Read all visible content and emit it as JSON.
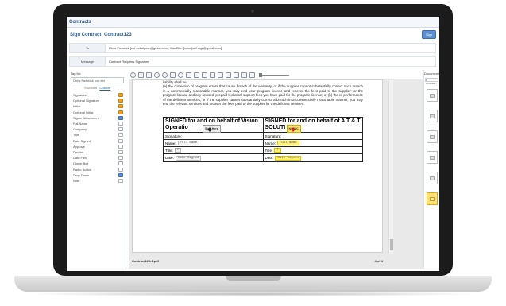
{
  "app": {
    "title": "Contracts"
  },
  "header": {
    "title": "Sign Contract: Contract123",
    "sign_label": "Sign"
  },
  "to": {
    "label": "To",
    "value": "Chris Fishwick [cnf.ext.signer@gmail.com]; MaoDtu Quinn [cnf.mgr@gmail.com];"
  },
  "message": {
    "label": "Message",
    "value": "Contract Requires Signature"
  },
  "left": {
    "tag_for_label": "Tag for:",
    "tag_for_value": "Chris Fishwick [cnf.ext",
    "tab_standard": "Standard",
    "tab_custom": "Custom",
    "fields": [
      {
        "label": "Signature",
        "icon": "signature-icon",
        "style": "orange"
      },
      {
        "label": "Optional Signature",
        "icon": "optional-signature-icon",
        "style": "orange"
      },
      {
        "label": "Initial",
        "icon": "initial-icon",
        "style": "orange"
      },
      {
        "label": "Optional Initial",
        "icon": "optional-initial-icon",
        "style": "orange"
      },
      {
        "label": "Signer Attachment",
        "icon": "attachment-icon",
        "style": "blue"
      },
      {
        "label": "Full Name",
        "icon": "full-name-icon",
        "style": "plain"
      },
      {
        "label": "Company",
        "icon": "company-icon",
        "style": "plain"
      },
      {
        "label": "Title",
        "icon": "title-icon",
        "style": "plain"
      },
      {
        "label": "Date Signed",
        "icon": "date-signed-icon",
        "style": "plain"
      },
      {
        "label": "Approve",
        "icon": "approve-icon",
        "style": "plain"
      },
      {
        "label": "Decline",
        "icon": "decline-icon",
        "style": "plain"
      },
      {
        "label": "Data Field",
        "icon": "data-field-icon",
        "style": "plain"
      },
      {
        "label": "Check Box",
        "icon": "checkbox-icon",
        "style": "plain"
      },
      {
        "label": "Radio Button",
        "icon": "radio-button-icon",
        "style": "plain"
      },
      {
        "label": "Drop Down",
        "icon": "dropdown-icon",
        "style": "blue"
      },
      {
        "label": "Note",
        "icon": "note-icon",
        "style": "plain"
      }
    ]
  },
  "doc": {
    "para_top": "liability shall be:",
    "para": "(a) the correction of program errors that cause breach of the warranty, or if the supplier cannot substantially correct such breach in a commercially reasonable manner, you may end your program license and recover the fees paid to the supplier for the program license and any unused, prepaid technical support fees you have paid for the program license; or (b) the re-performance of the deficient services, or if the supplier cannot substantially correct a breach in a commercially reasonable manner, you may end the relevant services and recover the fees paid to the supplier for the deficient services.",
    "left_head": "SIGNED for and on behalf of Vision Operatio",
    "right_head": "SIGNED for and on behalf of A T & T SOLUTI",
    "left_float": "Sign Here",
    "right_float": "NS INC",
    "rows": [
      {
        "label": "Signature:",
        "left_tag": "",
        "right_tag": ""
      },
      {
        "label": "Name:",
        "left_tag": "Full Name",
        "right_tag": "Full Name"
      },
      {
        "label": "Title:",
        "left_tag": "T",
        "right_tag": "T"
      },
      {
        "label": "Date:",
        "left_tag": "Date Signed",
        "right_tag": "Date Signed"
      }
    ],
    "filename": "Contract123-1.pdf",
    "page_of": "4 of 4"
  },
  "right": {
    "title": "Documents",
    "select": "▾ Contract..."
  }
}
